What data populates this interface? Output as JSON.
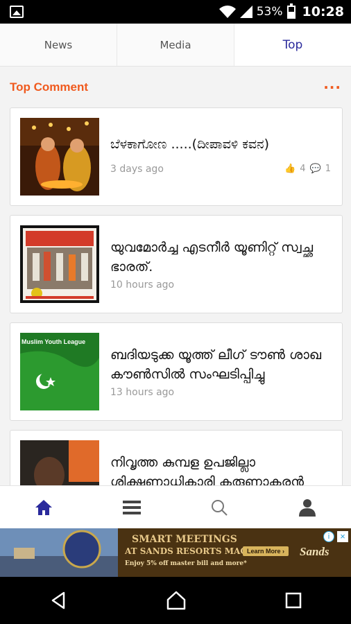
{
  "status_bar": {
    "battery": "53%",
    "time": "10:28"
  },
  "tabs": [
    {
      "label": "News"
    },
    {
      "label": "Media"
    },
    {
      "label": "Top"
    }
  ],
  "section": {
    "title": "Top Comment",
    "more": "···"
  },
  "cards": [
    {
      "title": "ಬೆಳಕಾಗೋಣ .....(ದೀಪಾವಳಿ ಕವನ)",
      "time": "3 days ago",
      "likes": "4",
      "comments": "1"
    },
    {
      "title": "യുവമോർച്ച എടനീർ യൂണിറ്റ് സ്വച്ഛ ഭാരത്.",
      "time": "10 hours ago"
    },
    {
      "title": "ബദിയടുക്ക യൂത്ത് ലീഗ് ടൗൺ ശാഖ കൗൺസിൽ സംഘടിപ്പിച്ചു",
      "time": "13 hours ago",
      "thumb_text": "Muslim Youth League"
    },
    {
      "title": "നിവൃത്ത കുമ്പള ഉപജില്ലാ ശിക്ഷണാധികാരി കരുണാകരന്‍ അനന്തപുര നിധന"
    }
  ],
  "bottom_nav": [
    {
      "icon": "home-icon"
    },
    {
      "icon": "menu-icon"
    },
    {
      "icon": "search-icon"
    },
    {
      "icon": "profile-icon"
    }
  ],
  "ad": {
    "headline": "SMART MEETINGS",
    "subline": "AT SANDS RESORTS MACAO",
    "offer": "Enjoy 5% off master bill and more*",
    "cta": "Learn More ›",
    "brand": "Sands"
  },
  "colors": {
    "accent": "#f05a1e",
    "active_tab": "#2a2a9c"
  }
}
